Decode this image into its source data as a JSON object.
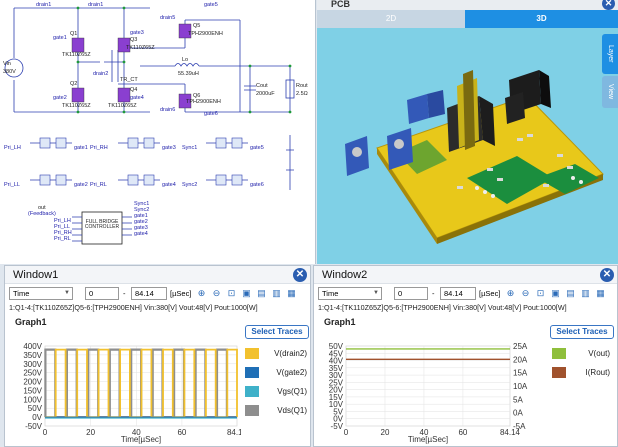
{
  "schematic": {
    "labels": {
      "vin": "Vin",
      "vin_val": "380V",
      "drain1": "drain1",
      "drain2": "drain2",
      "drain3": "drain3",
      "drain4": "drain4",
      "drain5": "drain5",
      "drain6": "drain6",
      "gate1": "gate1",
      "gate2": "gate2",
      "gate3": "gate3",
      "gate4": "gate4",
      "gate5": "gate5",
      "gate6": "gate6",
      "q1": "Q1",
      "q2": "Q2",
      "q3": "Q3",
      "q4": "Q4",
      "q5": "Q5",
      "q6": "Q6",
      "q_part": "TK110Z65Z",
      "q5_part": "TPH2900ENH",
      "tr": "TR_CT",
      "lo": "Lo",
      "lo_val": "55.39uH",
      "cout": "Cout",
      "cout_val": "2000uF",
      "rout": "Rout",
      "rout_val": "2.5Ω",
      "pri_lh": "Pri_LH",
      "pri_ll": "Pri_LL",
      "pri_rh": "Pri_RH",
      "pri_rl": "Pri_RL",
      "sync1": "Sync1",
      "sync2": "Sync2",
      "feedback": "(Feedback)",
      "controller": "FULL BRIDGE CONTROLLER",
      "out": "out"
    }
  },
  "pcb": {
    "title": "PCB",
    "close": "✕",
    "tab_2d": "2D",
    "tab_3d": "3D",
    "side_layer": "Layer",
    "side_view": "View"
  },
  "window1": {
    "title": "Window1",
    "close": "✕",
    "axis_select": "Time",
    "start": "0",
    "end": "84.14",
    "unit": "[µSec]",
    "info": "1:Q1-4:[TK110Z65Z]Q5-6:[TPH2900ENH]  Vin:380[V]  Vout:48[V]  Pout:1000[W]",
    "graph_name": "Graph1",
    "select_traces": "Select Traces",
    "legend": [
      {
        "label": "V(drain2)",
        "color": "#f2c12e"
      },
      {
        "label": "V(gate2)",
        "color": "#1f6fb6"
      },
      {
        "label": "Vgs(Q1)",
        "color": "#3fb1c9"
      },
      {
        "label": "Vds(Q1)",
        "color": "#8e8e8e"
      }
    ],
    "x_title": "Time[µSec]"
  },
  "window2": {
    "title": "Window2",
    "close": "✕",
    "axis_select": "Time",
    "start": "0",
    "end": "84.14",
    "unit": "[µSec]",
    "info": "1:Q1-4:[TK110Z65Z]Q5-6:[TPH2900ENH]  Vin:380[V]  Vout:48[V]  Pout:1000[W]",
    "graph_name": "Graph1",
    "select_traces": "Select Traces",
    "legend": [
      {
        "label": "V(out)",
        "color": "#8fbf3c"
      },
      {
        "label": "I(Rout)",
        "color": "#a0522d"
      }
    ],
    "x_title": "Time[µSec]"
  },
  "chart_data": [
    {
      "type": "line",
      "title": "Graph1",
      "xlabel": "Time[µSec]",
      "ylabel": "",
      "xlim": [
        0,
        84.14
      ],
      "ylim": [
        -50,
        400
      ],
      "x_ticks": [
        "0",
        "20",
        "40",
        "60",
        "84.14"
      ],
      "y_ticks": [
        "400V",
        "350V",
        "300V",
        "250V",
        "200V",
        "150V",
        "100V",
        "50V",
        "0V",
        "-50V"
      ],
      "period_us": 9.4,
      "series": [
        {
          "name": "V(drain2)",
          "color": "#f2c12e",
          "high": 380,
          "low": 0
        },
        {
          "name": "V(gate2)",
          "color": "#1f6fb6",
          "high": 0,
          "low": 0
        },
        {
          "name": "Vgs(Q1)",
          "color": "#3fb1c9",
          "high": 0,
          "low": 0
        },
        {
          "name": "Vds(Q1)",
          "color": "#8e8e8e",
          "high": 380,
          "low": 0
        }
      ]
    },
    {
      "type": "line",
      "title": "Graph1",
      "xlabel": "Time[µSec]",
      "xlim": [
        0,
        84.14
      ],
      "ylim_left": [
        -5,
        50
      ],
      "ylim_right": [
        -5,
        25
      ],
      "x_ticks": [
        "0",
        "20",
        "40",
        "60",
        "84.14"
      ],
      "y_ticks_left": [
        "50V",
        "45V",
        "40V",
        "35V",
        "30V",
        "25V",
        "20V",
        "15V",
        "10V",
        "5V",
        "0V",
        "-5V"
      ],
      "y_ticks_right": [
        "25A",
        "20A",
        "15A",
        "10A",
        "5A",
        "0A",
        "-5A"
      ],
      "series": [
        {
          "name": "V(out)",
          "color": "#8fbf3c",
          "axis": "left",
          "x": [
            0,
            84.14
          ],
          "y": [
            48,
            48
          ]
        },
        {
          "name": "I(Rout)",
          "color": "#a0522d",
          "axis": "right",
          "x": [
            0,
            84.14
          ],
          "y": [
            20,
            20
          ]
        }
      ]
    }
  ]
}
